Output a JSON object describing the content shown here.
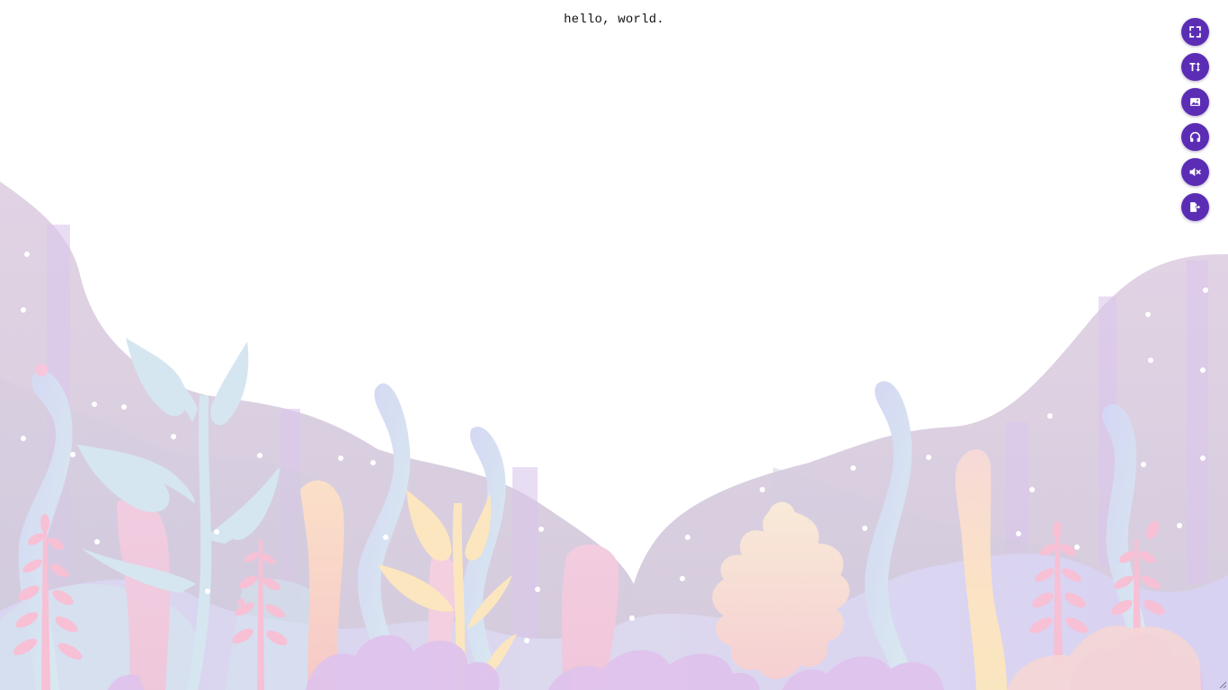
{
  "editor": {
    "text": "hello, world."
  },
  "toolbar": {
    "buttons": [
      {
        "id": "fullscreen",
        "icon": "fullscreen-icon"
      },
      {
        "id": "font-size",
        "icon": "text-size-icon"
      },
      {
        "id": "background",
        "icon": "image-icon"
      },
      {
        "id": "sound",
        "icon": "headphones-icon"
      },
      {
        "id": "mute",
        "icon": "volume-mute-icon"
      },
      {
        "id": "export",
        "icon": "export-icon"
      }
    ]
  },
  "colors": {
    "accent": "#5b2db5",
    "background": "#ffffff",
    "text": "#111111",
    "scene_purple": "#d6cde0",
    "scene_blue": "#d7dcf2",
    "scene_pink": "#f6c6d8",
    "scene_peach": "#f9d9c2",
    "scene_leaf": "#d5e6f0"
  }
}
